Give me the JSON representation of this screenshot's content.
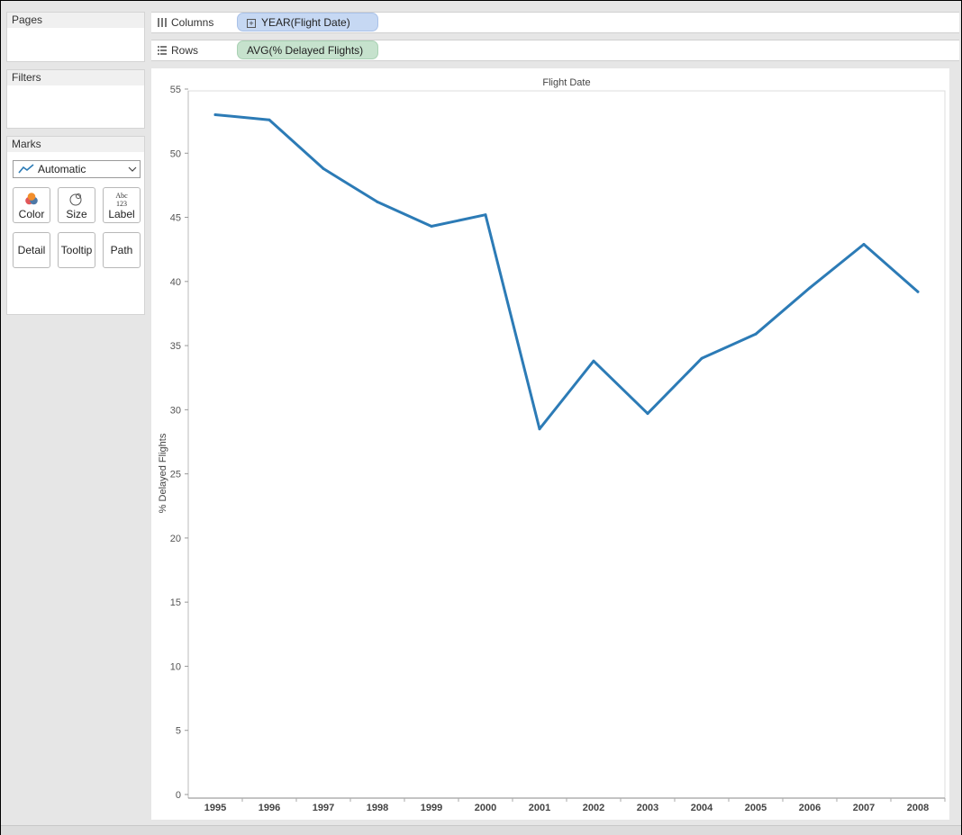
{
  "pages": {
    "header": "Pages"
  },
  "filters": {
    "header": "Filters"
  },
  "marks": {
    "header": "Marks",
    "type_selected": "Automatic",
    "buttons": [
      {
        "label": "Color",
        "icon": "color-icon"
      },
      {
        "label": "Size",
        "icon": "size-icon"
      },
      {
        "label": "Label",
        "icon": "label-icon"
      },
      {
        "label": "Detail",
        "icon": ""
      },
      {
        "label": "Tooltip",
        "icon": ""
      },
      {
        "label": "Path",
        "icon": ""
      }
    ],
    "label_icon_text": {
      "top": "Abc",
      "bottom": "123"
    }
  },
  "shelves": {
    "columns": {
      "label": "Columns",
      "pill": "YEAR(Flight Date)",
      "pill_color": "#c6d8f3"
    },
    "rows": {
      "label": "Rows",
      "pill": "AVG(% Delayed Flights)",
      "pill_color": "#c6e2cd"
    }
  },
  "colors": {
    "line": "#2c7bb6",
    "axis": "#555555",
    "grid": "#e6e6e6"
  },
  "chart_data": {
    "type": "line",
    "title": "Flight Date",
    "xlabel": "",
    "ylabel": "% Delayed Flights",
    "ylim": [
      0,
      55
    ],
    "yticks": [
      0,
      5,
      10,
      15,
      20,
      25,
      30,
      35,
      40,
      45,
      50,
      55
    ],
    "categories": [
      "1995",
      "1996",
      "1997",
      "1998",
      "1999",
      "2000",
      "2001",
      "2002",
      "2003",
      "2004",
      "2005",
      "2006",
      "2007",
      "2008"
    ],
    "series": [
      {
        "values": [
          53.0,
          52.6,
          48.8,
          46.2,
          44.3,
          45.2,
          28.5,
          33.8,
          29.7,
          34.0,
          35.9,
          39.5,
          42.9,
          39.2
        ]
      }
    ],
    "grid": false,
    "legend": "none"
  }
}
